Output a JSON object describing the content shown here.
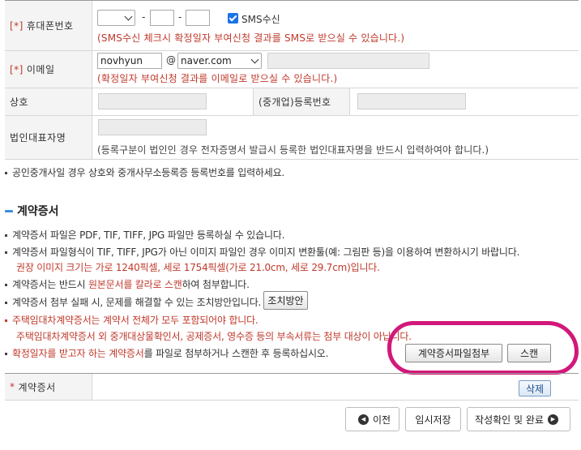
{
  "form": {
    "phone": {
      "label": "휴대폰번호",
      "required_mark": "[*]",
      "sep1": "-",
      "sep2": "-",
      "sms_label": "SMS수신",
      "note": "(SMS수신 체크시 확정일자 부여신청 결과를 SMS로 받으실 수 있습니다.)"
    },
    "email": {
      "label": "이메일",
      "required_mark": "[*]",
      "local_value": "novhyun",
      "at": "@",
      "domain_value": "naver.com",
      "note": "(확정일자 부여신청 결과를 이메일로 받으실 수 있습니다.)"
    },
    "company": {
      "label": "상호",
      "reg_label": "(중개업)등록번호"
    },
    "rep": {
      "label": "법인대표자명",
      "note": "(등록구분이 법인인 경우 전자증명서 발급시 등록한 법인대표자명을 반드시 입력하여야 합니다.)"
    }
  },
  "notice_broker": "공인중개사일 경우 상호와 중개사무소등록증 등록번호를 입력하세요.",
  "contract": {
    "title": "계약증서",
    "b1": "계약증서 파일은 PDF, TIF, TIFF, JPG 파일만 등록하실 수 있습니다.",
    "b2": "계약증서 파일형식이 TIF, TIFF, JPG가 아닌 이미지 파일인 경우 이미지 변환툴(예: 그림판 등)을 이용하여 변환하시기 바랍니다.",
    "b2_sub": "권장 이미지 크기는 가로 1240픽셀, 세로 1754픽셀(가로 21.0cm, 세로 29.7cm)입니다.",
    "b3_pre": "계약증서는 반드시 ",
    "b3_red": "원본문서를 칼라로 스캔",
    "b3_post": "하여 첨부합니다.",
    "b4": "계약증서 첨부 실패 시, 문제를 해결할 수 있는 조치방안입니다.",
    "b4_button": "조치방안",
    "b5_red1": "주택임대차계약증서는 계약서 전체가 모두 포함되어야 합니다.",
    "b5_sub": "주택임대차계약증서 외 중개대상물확인서, 공제증서, 영수증 등의 부속서류는 첨부 대상이 아닙니다.",
    "b6_red": "확정일자를 받고자 하는 계약증서",
    "b6_post": "를 파일로 첨부하거나 스캔한 후 등록하십시오.",
    "attach_button": "계약증서파일첨부",
    "scan_button": "스캔",
    "row_label": "계약증서",
    "row_required": "*",
    "delete_button": "삭제"
  },
  "nav": {
    "prev": "이전",
    "temp_save": "임시저장",
    "confirm": "작성확인 및 완료"
  },
  "colors": {
    "required": "#c0392b",
    "highlight": "#d2187a",
    "checkbox": "#1a73e8"
  }
}
